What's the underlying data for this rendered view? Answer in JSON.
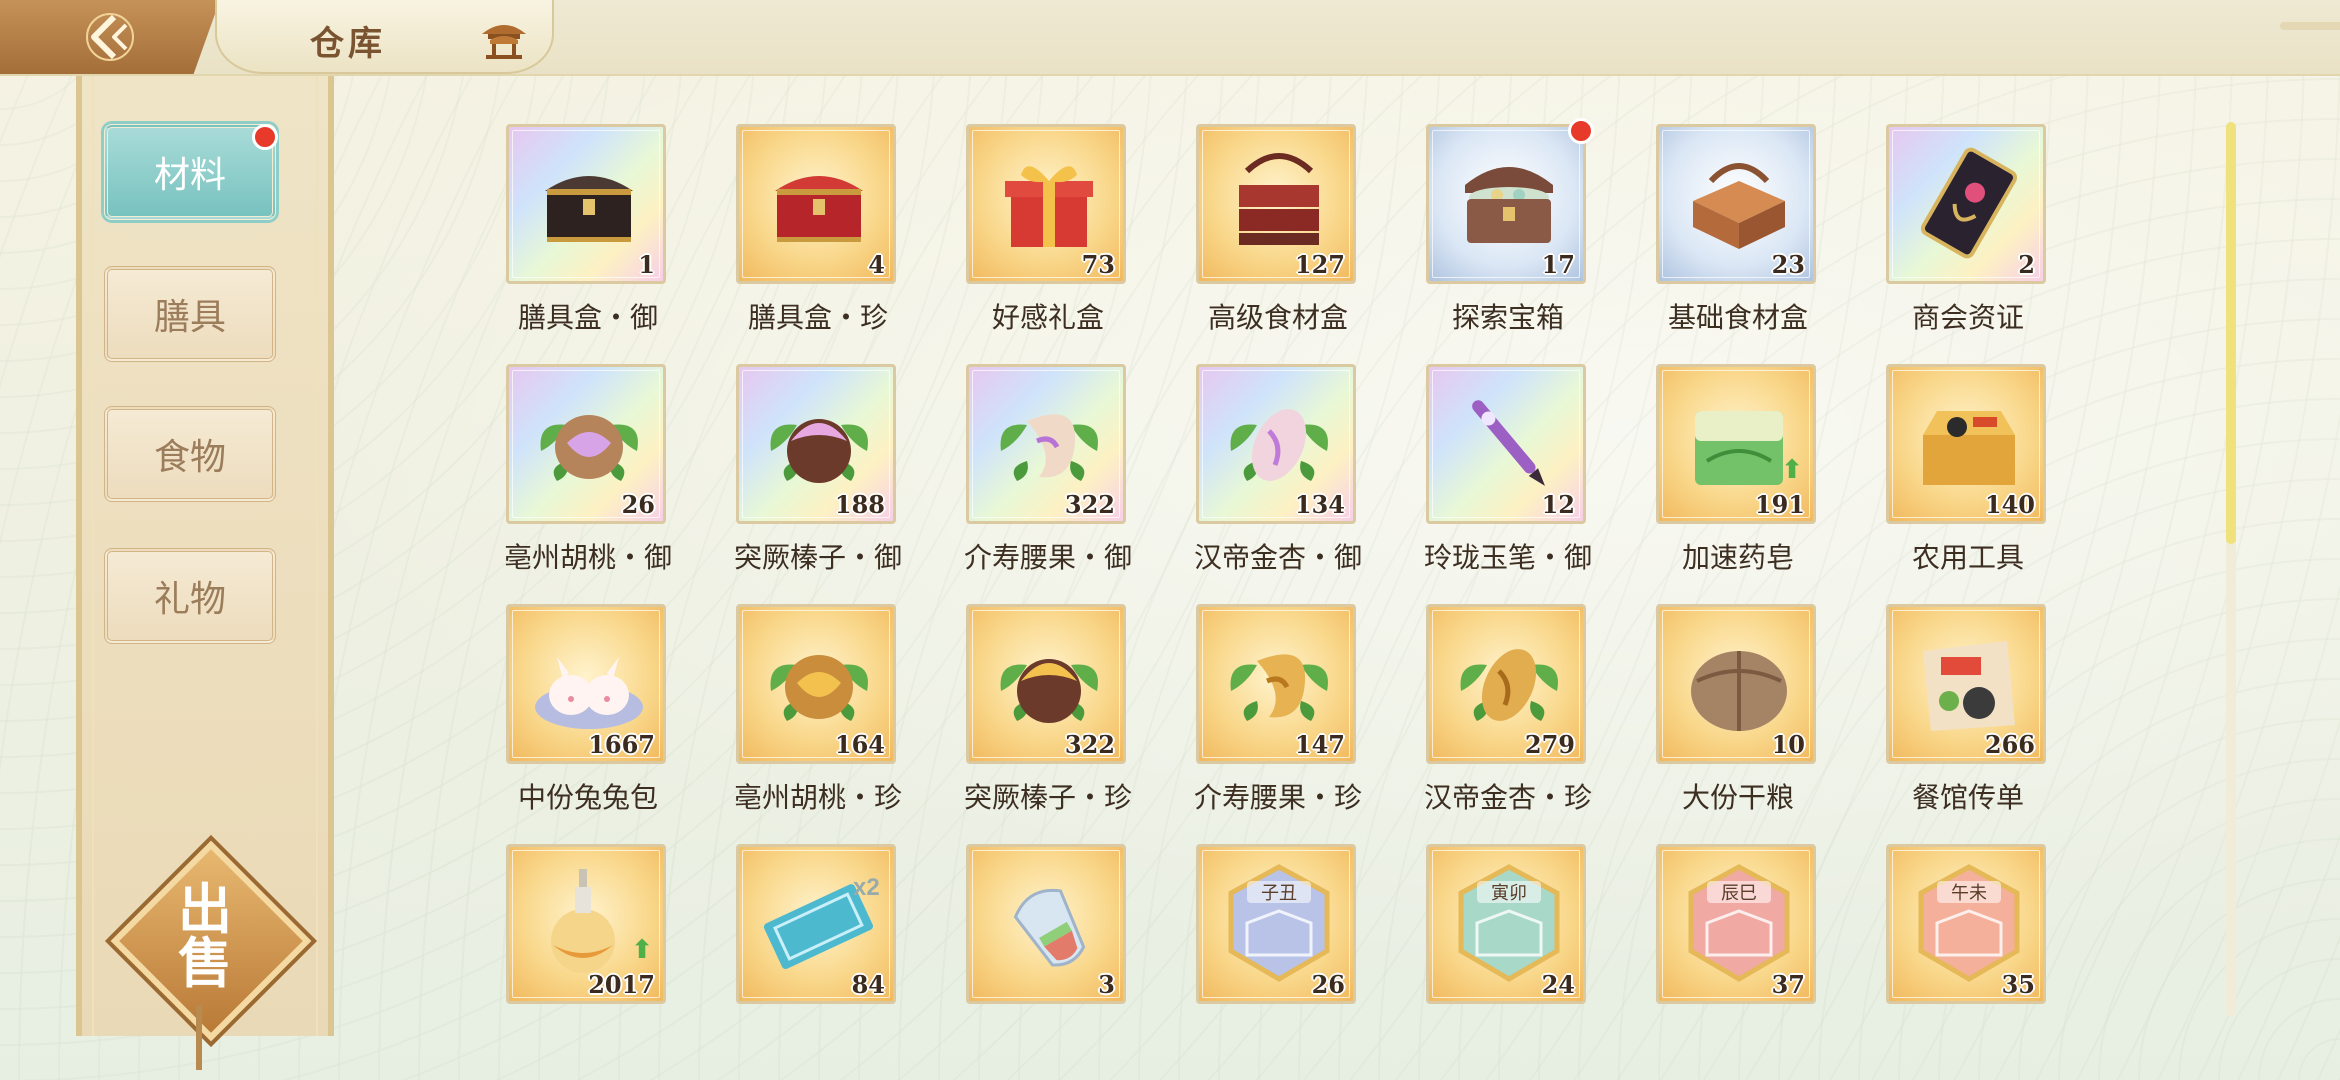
{
  "header": {
    "title": "仓库",
    "back_icon": "back-arrow-icon",
    "title_icon": "pavilion-icon"
  },
  "sidebar": {
    "tabs": [
      {
        "label": "材料",
        "active": true,
        "badge": true
      },
      {
        "label": "膳具",
        "active": false,
        "badge": false
      },
      {
        "label": "食物",
        "active": false,
        "badge": false
      },
      {
        "label": "礼物",
        "active": false,
        "badge": false
      }
    ],
    "sell_button": {
      "label_line1": "出",
      "label_line2": "售"
    }
  },
  "colors": {
    "active_tab": "#78c2bf",
    "badge": "#e83a2a",
    "card_border": "#dbc9a1",
    "scroll_thumb": "#efe27c"
  },
  "items": [
    {
      "name": "膳具盒・御",
      "count": "1",
      "rarity": "rainbow",
      "icon": "black-treasure-chest-icon",
      "badge": false
    },
    {
      "name": "膳具盒・珍",
      "count": "4",
      "rarity": "gold",
      "icon": "red-treasure-chest-icon",
      "badge": false
    },
    {
      "name": "好感礼盒",
      "count": "73",
      "rarity": "gold",
      "icon": "gift-box-icon",
      "badge": false
    },
    {
      "name": "高级食材盒",
      "count": "127",
      "rarity": "gold",
      "icon": "food-basket-icon",
      "badge": false
    },
    {
      "name": "探索宝箱",
      "count": "17",
      "rarity": "blue",
      "icon": "open-treasure-chest-icon",
      "badge": true
    },
    {
      "name": "基础食材盒",
      "count": "23",
      "rarity": "blue",
      "icon": "wooden-box-icon",
      "badge": false
    },
    {
      "name": "商会资证",
      "count": "2",
      "rarity": "rainbow",
      "icon": "merchant-card-icon",
      "badge": false
    },
    {
      "name": "亳州胡桃・御",
      "count": "26",
      "rarity": "rainbow",
      "icon": "walnut-icon",
      "badge": false
    },
    {
      "name": "突厥榛子・御",
      "count": "188",
      "rarity": "rainbow",
      "icon": "hazelnut-icon",
      "badge": false
    },
    {
      "name": "介寿腰果・御",
      "count": "322",
      "rarity": "rainbow",
      "icon": "cashew-icon",
      "badge": false
    },
    {
      "name": "汉帝金杏・御",
      "count": "134",
      "rarity": "rainbow",
      "icon": "almond-icon",
      "badge": false
    },
    {
      "name": "玲珑玉笔・御",
      "count": "12",
      "rarity": "rainbow",
      "icon": "jade-brush-icon",
      "badge": false
    },
    {
      "name": "加速药皂",
      "count": "191",
      "rarity": "gold",
      "icon": "soap-icon",
      "badge": false,
      "boost": true
    },
    {
      "name": "农用工具",
      "count": "140",
      "rarity": "gold",
      "icon": "toolbox-icon",
      "badge": false
    },
    {
      "name": "中份兔兔包",
      "count": "1667",
      "rarity": "gold",
      "icon": "bunny-bun-icon",
      "badge": false
    },
    {
      "name": "亳州胡桃・珍",
      "count": "164",
      "rarity": "gold",
      "icon": "walnut-icon",
      "badge": false
    },
    {
      "name": "突厥榛子・珍",
      "count": "322",
      "rarity": "gold",
      "icon": "hazelnut-icon",
      "badge": false
    },
    {
      "name": "介寿腰果・珍",
      "count": "147",
      "rarity": "gold",
      "icon": "cashew-icon",
      "badge": false
    },
    {
      "name": "汉帝金杏・珍",
      "count": "279",
      "rarity": "gold",
      "icon": "almond-icon",
      "badge": false
    },
    {
      "name": "大份干粮",
      "count": "10",
      "rarity": "gold",
      "icon": "ration-bundle-icon",
      "badge": false
    },
    {
      "name": "餐馆传单",
      "count": "266",
      "rarity": "gold",
      "icon": "flyer-scroll-icon",
      "badge": false
    },
    {
      "name": "",
      "count": "2017",
      "rarity": "gold",
      "icon": "potion-bottle-icon",
      "badge": false,
      "boost": true
    },
    {
      "name": "",
      "count": "84",
      "rarity": "gold",
      "icon": "ticket-icon",
      "badge": false,
      "multiplier": "x2"
    },
    {
      "name": "",
      "count": "3",
      "rarity": "gold",
      "icon": "glass-scoop-icon",
      "badge": false
    },
    {
      "name": "",
      "count": "26",
      "rarity": "gold",
      "icon": "zodiac-badge-icon",
      "badge": false,
      "badge_text": "子丑",
      "tint": "#b9c3e8"
    },
    {
      "name": "",
      "count": "24",
      "rarity": "gold",
      "icon": "zodiac-badge-icon",
      "badge": false,
      "badge_text": "寅卯",
      "tint": "#a8d8c8"
    },
    {
      "name": "",
      "count": "37",
      "rarity": "gold",
      "icon": "zodiac-badge-icon",
      "badge": false,
      "badge_text": "辰巳",
      "tint": "#f1a9a4"
    },
    {
      "name": "",
      "count": "35",
      "rarity": "gold",
      "icon": "zodiac-badge-icon",
      "badge": false,
      "badge_text": "午未",
      "tint": "#f4b09a"
    }
  ]
}
